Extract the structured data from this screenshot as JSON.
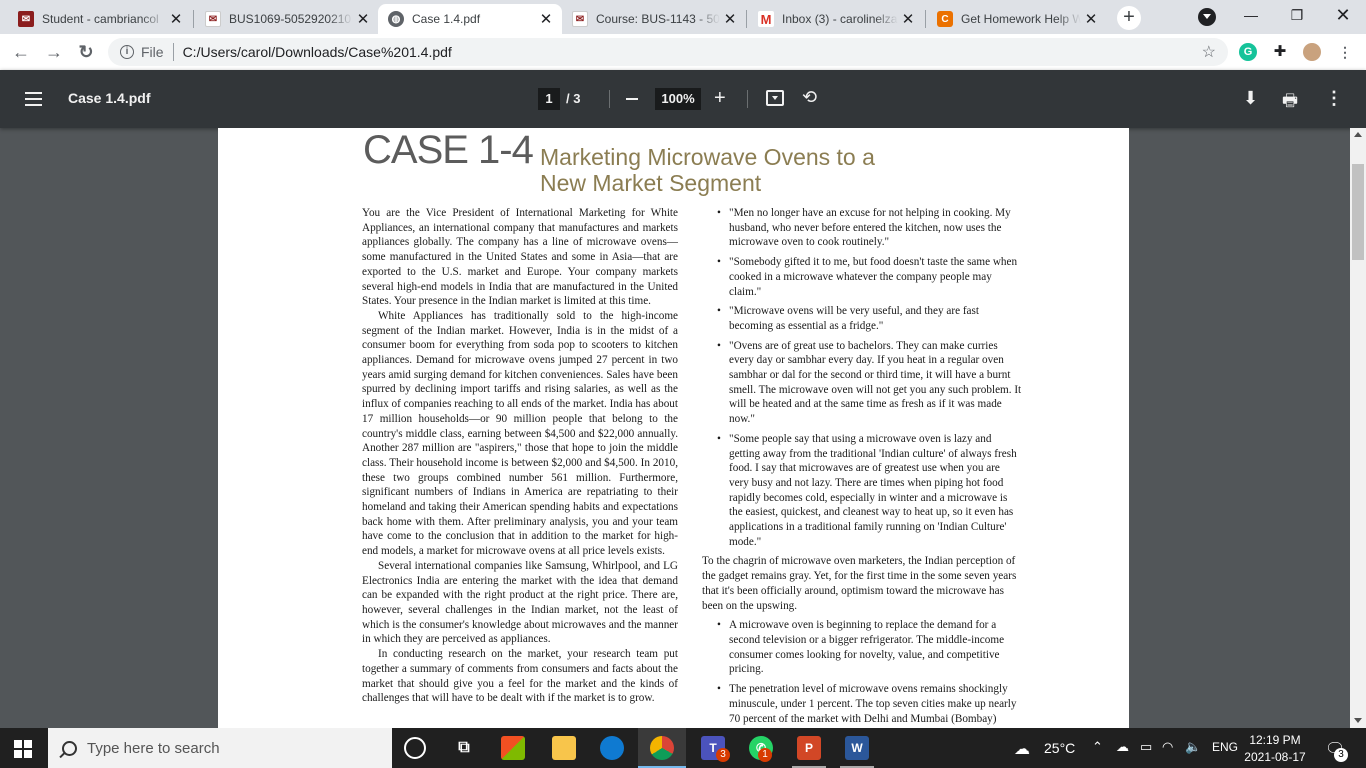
{
  "tabs": [
    {
      "title": "Student - cambriancol",
      "favicon": "bullhorn-icon",
      "active": false
    },
    {
      "title": "BUS1069-5052920210",
      "favicon": "bullhorn-icon",
      "active": false
    },
    {
      "title": "Case 1.4.pdf",
      "favicon": "globe-icon",
      "active": true
    },
    {
      "title": "Course: BUS-1143 - 50",
      "favicon": "bullhorn-icon",
      "active": false
    },
    {
      "title": "Inbox (3) - carolinelza",
      "favicon": "gmail-icon",
      "active": false
    },
    {
      "title": "Get Homework Help W",
      "favicon": "chegg-icon",
      "active": false
    }
  ],
  "address": {
    "scheme_label": "File",
    "url": "C:/Users/carol/Downloads/Case%201.4.pdf"
  },
  "pdf": {
    "title": "Case 1.4.pdf",
    "current_page": "1",
    "total_pages": "/ 3",
    "zoom": "100%"
  },
  "document": {
    "case_label": "CASE 1-4",
    "subtitle_line1": "Marketing Microwave Ovens to a",
    "subtitle_line2": "New Market Segment",
    "left_paragraphs": [
      "You are the Vice President of International Marketing for White Appliances, an international company that manufactures and markets appliances globally. The company has a line of microwave ovens—some manufactured in the United States and some in Asia—that are exported to the U.S. market and Europe. Your company markets several high-end models in India that are manufactured in the United States. Your presence in the Indian market is limited at this time.",
      "White Appliances has traditionally sold to the high-income segment of the Indian market. However, India is in the midst of a consumer boom for everything from soda pop to scooters to kitchen appliances. Demand for microwave ovens jumped 27 percent in two years amid surging demand for kitchen conveniences. Sales have been spurred by declining import tariffs and rising salaries, as well as the influx of companies reaching to all ends of the market. India has about 17 million households—or 90 million people that belong to the country's middle class, earning between $4,500 and $22,000 annually. Another 287 million are \"aspirers,\" those that hope to join the middle class. Their household income is between $2,000 and $4,500. In 2010, these two groups combined number 561 million. Furthermore, significant numbers of Indians in America are repatriating to their homeland and taking their American spending habits and expectations back home with them. After preliminary analysis, you and your team have come to the conclusion that in addition to the market for high-end models, a market for microwave ovens at all price levels exists.",
      "Several international companies like Samsung, Whirlpool, and LG Electronics India are entering the market with the idea that demand can be expanded with the right product at the right price. There are, however, several challenges in the Indian market, not the least of which is the consumer's knowledge about microwaves and the manner in which they are perceived as appliances.",
      "In conducting research on the market, your research team put together a summary of comments from consumers and facts about the market that should give you a feel for the market and the kinds of challenges that will have to be dealt with if the market is to grow."
    ],
    "right_bullets_top": [
      "\"Men no longer have an excuse for not helping in cooking. My husband, who never before entered the kitchen, now uses the microwave oven to cook routinely.\"",
      "\"Somebody gifted it to me, but food doesn't taste the same when cooked in a microwave whatever the company people may claim.\"",
      "\"Microwave ovens will be very useful, and they are fast becoming as essential as a fridge.\"",
      "\"Ovens are of great use to bachelors. They can make curries every day or sambhar every day. If you heat in a regular oven sambhar or dal for the second or third time, it will have a burnt smell. The microwave oven will not get you any such problem. It will be heated and at the same time as fresh as if it was made now.\"",
      "\"Some people say that using a microwave oven is lazy and getting away from the traditional 'Indian culture' of always fresh food. I say that microwaves are of greatest use when you are very busy and not lazy. There are times when piping hot food rapidly becomes cold, especially in winter and a microwave is the easiest, quickest, and cleanest way to heat up, so it even has applications in a traditional family running on 'Indian Culture' mode.\""
    ],
    "right_paragraph": "To the chagrin of microwave oven marketers, the Indian perception of the gadget remains gray. Yet, for the first time in the some seven years that it's been officially around, optimism toward the microwave has been on the upswing.",
    "right_bullets_bottom": [
      "A microwave oven is beginning to replace the demand for a second television or a bigger refrigerator. The middle-income consumer comes looking for novelty, value, and competitive pricing.",
      "The penetration level of microwave ovens remains shockingly minuscule, under 1 percent. The top seven cities make up nearly 70 percent of the market with Delhi and Mumbai (Bombay) accounting the highest sales. But the good news is"
    ]
  },
  "taskbar": {
    "search_placeholder": "Type here to search",
    "weather": "25°C",
    "language": "ENG",
    "time": "12:19 PM",
    "date": "2021-08-17",
    "notification_count": "3",
    "teams_badge": "3",
    "whatsapp_badge": "1"
  },
  "colors": {
    "pdf_toolbar": "#323639",
    "viewer_bg": "#525659",
    "subtitle": "#8b7d52"
  }
}
